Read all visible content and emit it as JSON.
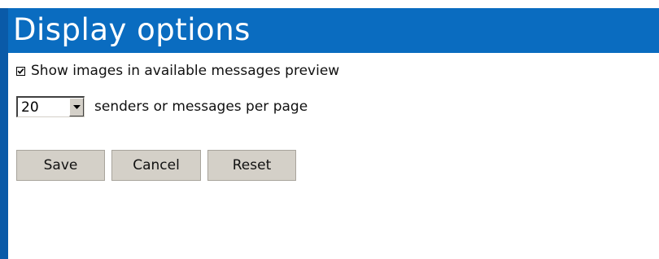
{
  "header": {
    "title": "Display options"
  },
  "options": {
    "show_images_label": "Show images in available messages preview",
    "show_images_checked": true,
    "per_page_value": "20",
    "per_page_label": "senders or messages per page"
  },
  "actions": {
    "save_label": "Save",
    "cancel_label": "Cancel",
    "reset_label": "Reset"
  },
  "colors": {
    "header_bg": "#0a6cc0",
    "left_border": "#0a5aa8",
    "button_bg": "#d4d0c8"
  },
  "icons": {
    "checkbox_mark": "checkmark-icon",
    "dropdown": "chevron-down-icon"
  }
}
